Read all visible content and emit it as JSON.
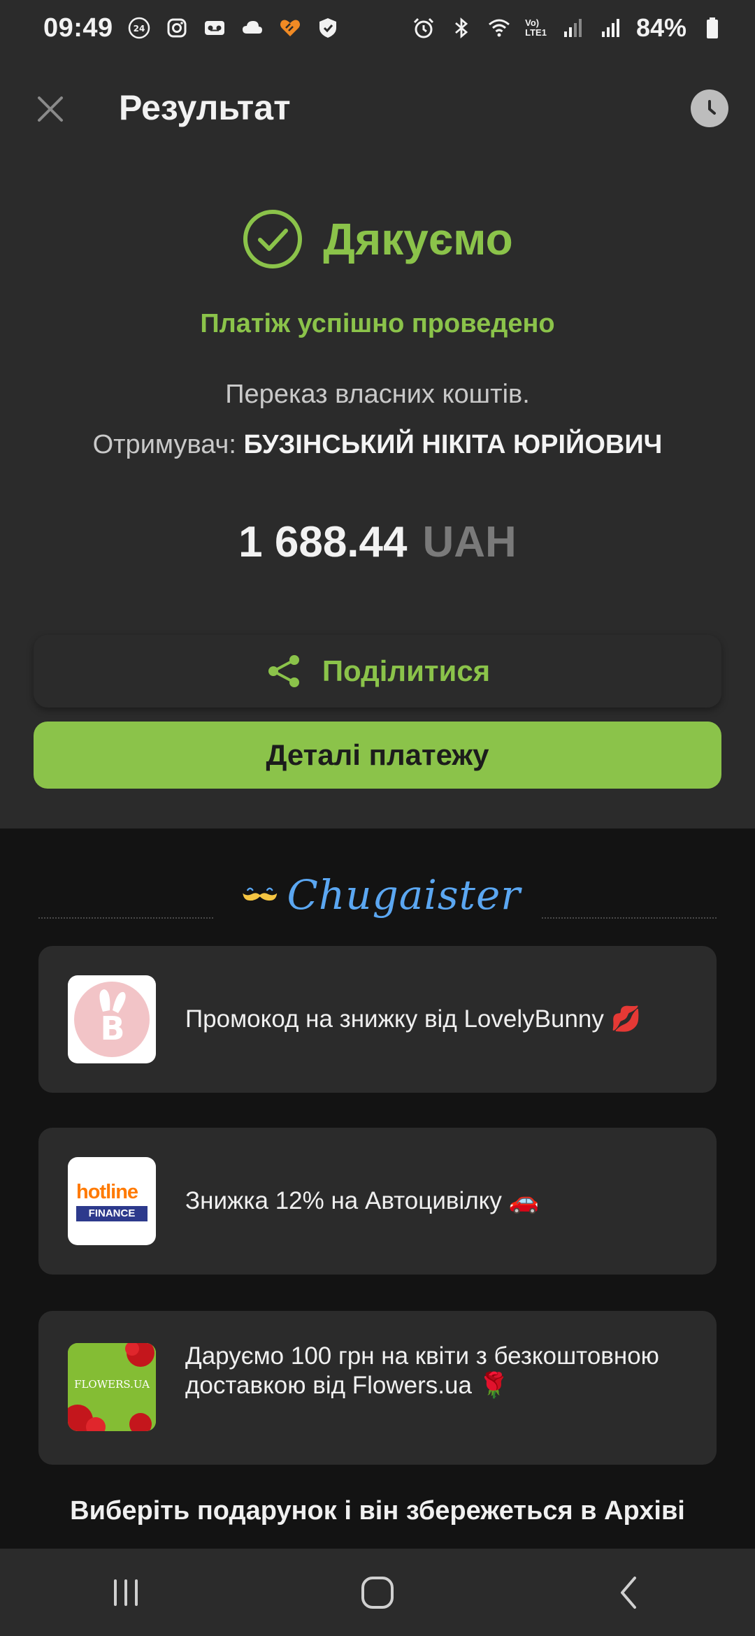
{
  "status_bar": {
    "time": "09:49",
    "battery": "84%",
    "lte_top": "Vo)",
    "lte_bottom": "LTE1"
  },
  "header": {
    "title": "Результат",
    "close_icon": "close-icon",
    "history_icon": "clock-icon"
  },
  "result": {
    "title": "Дякуємо",
    "status": "Платіж успішно проведено",
    "description": "Переказ власних коштів.",
    "recipient_label": "Отримувач:",
    "recipient_name": "БУЗІНСЬКИЙ НІКІТА ЮРІЙОВИЧ",
    "amount": "1 688.44",
    "currency": "UAH"
  },
  "actions": {
    "share_label": "Поділитися",
    "details_label": "Деталі платежу"
  },
  "offers": {
    "brand": "Chugaister",
    "items": [
      {
        "text": "Промокод на знижку від LovelyBunny 💋",
        "logo": "lovelybunny-logo"
      },
      {
        "text": "Знижка 12% на Автоцивілку 🚗",
        "logo": "hotline-finance-logo",
        "logo_top": "hotline",
        "logo_bottom": "FINANCE"
      },
      {
        "text": "Даруємо 100 грн на квіти з безкоштовною доставкою від Flowers.ua 🌹",
        "logo": "flowers-ua-logo",
        "logo_label": "FLOWERS.UA"
      }
    ],
    "hint": "Виберіть подарунок і він збережеться в Архіві"
  },
  "colors": {
    "accent": "#8bc34a",
    "background": "#2b2b2b",
    "dark_background": "#131313",
    "chugaister_blue": "#5ba7f2"
  }
}
